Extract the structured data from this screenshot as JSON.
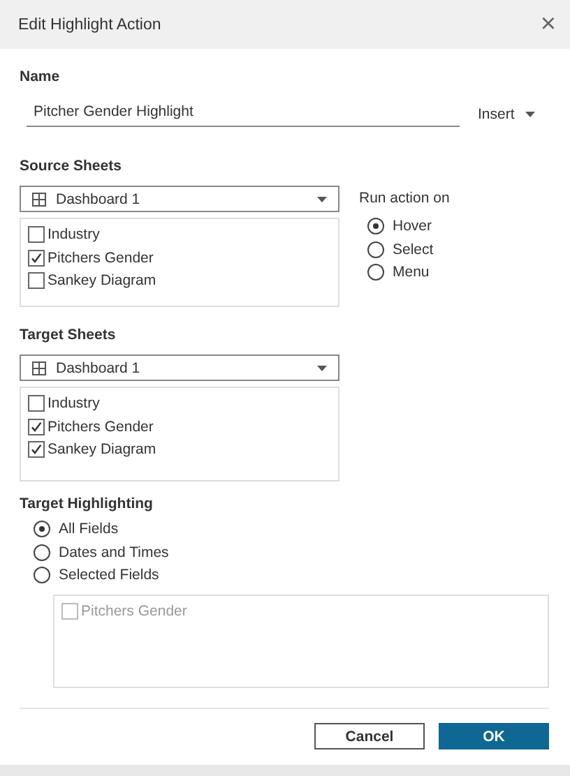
{
  "window": {
    "title": "Edit Highlight Action",
    "close": "×"
  },
  "name": {
    "label": "Name",
    "value": "Pitcher Gender Highlight",
    "insert": "Insert"
  },
  "source_sheets": {
    "label": "Source Sheets",
    "dropdown": "Dashboard 1",
    "items": [
      {
        "label": "Industry",
        "checked": false
      },
      {
        "label": "Pitchers Gender",
        "checked": true
      },
      {
        "label": "Sankey Diagram",
        "checked": false
      }
    ]
  },
  "run_action_on": {
    "label": "Run action on",
    "options": [
      {
        "label": "Hover",
        "selected": true
      },
      {
        "label": "Select",
        "selected": false
      },
      {
        "label": "Menu",
        "selected": false
      }
    ]
  },
  "target_sheets": {
    "label": "Target Sheets",
    "dropdown": "Dashboard 1",
    "items": [
      {
        "label": "Industry",
        "checked": false
      },
      {
        "label": "Pitchers Gender",
        "checked": true
      },
      {
        "label": "Sankey Diagram",
        "checked": true
      }
    ]
  },
  "target_highlighting": {
    "label": "Target Highlighting",
    "options": [
      {
        "label": "All Fields",
        "selected": true
      },
      {
        "label": "Dates and Times",
        "selected": false
      },
      {
        "label": "Selected Fields",
        "selected": false
      }
    ],
    "fields": [
      {
        "label": "Pitchers Gender",
        "checked": false,
        "disabled": true
      }
    ]
  },
  "buttons": [
    {
      "label": "Cancel",
      "kind": "secondary"
    },
    {
      "label": "OK",
      "kind": "primary"
    }
  ]
}
